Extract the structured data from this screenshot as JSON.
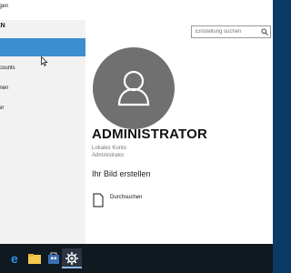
{
  "window": {
    "title": "ngen"
  },
  "sidebar": {
    "header": "EN",
    "items": [
      {
        "label": "",
        "selected": true
      },
      {
        "label": "ccounts"
      },
      {
        "label": "onen"
      },
      {
        "label": "zer"
      }
    ]
  },
  "search": {
    "placeholder": "Einstellung suchen",
    "icon": "search-icon"
  },
  "profile": {
    "avatar_icon": "user-avatar-icon",
    "name": "ADMINISTRATOR",
    "account_type": "Lokales Konto",
    "role": "Administrator",
    "picture_heading": "Ihr Bild erstellen",
    "browse_label": "Durchsuchen",
    "browse_icon": "file-icon"
  },
  "taskbar": {
    "items": [
      {
        "icon": "edge-icon"
      },
      {
        "icon": "file-explorer-icon"
      },
      {
        "icon": "store-icon"
      },
      {
        "icon": "settings-gear-icon",
        "active": true
      }
    ]
  },
  "colors": {
    "accent": "#3b8ed0",
    "avatar": "#707070",
    "taskbar": "#101820",
    "desktop": "#0b3a66"
  }
}
